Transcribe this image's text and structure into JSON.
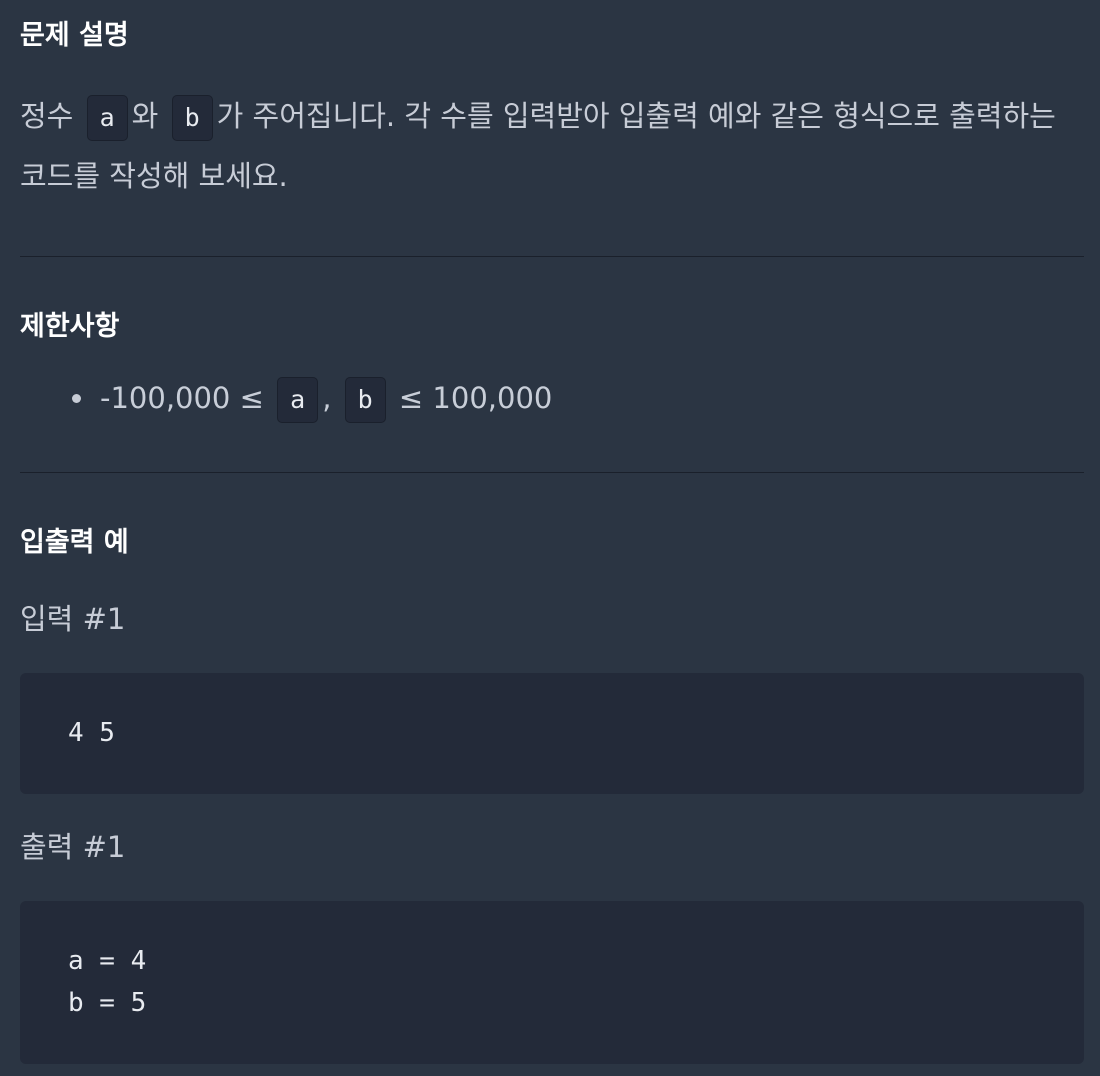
{
  "description": {
    "title": "문제 설명",
    "text_1": "정수",
    "code_a": "a",
    "text_2": "와",
    "code_b": "b",
    "text_3": "가 주어집니다. 각 수를 입력받아 입출력 예와 같은 형식으로 출력하는 코드를 작성해 보세요."
  },
  "constraints": {
    "title": "제한사항",
    "items": [
      {
        "prefix": "-100,000 ≤",
        "code_1": "a",
        "separator": ",",
        "code_2": "b",
        "suffix": "≤ 100,000"
      }
    ]
  },
  "examples": {
    "title": "입출력 예",
    "input_label": "입력 #1",
    "input_text": "4 5",
    "output_label": "출력 #1",
    "output_text": "a = 4\nb = 5"
  }
}
